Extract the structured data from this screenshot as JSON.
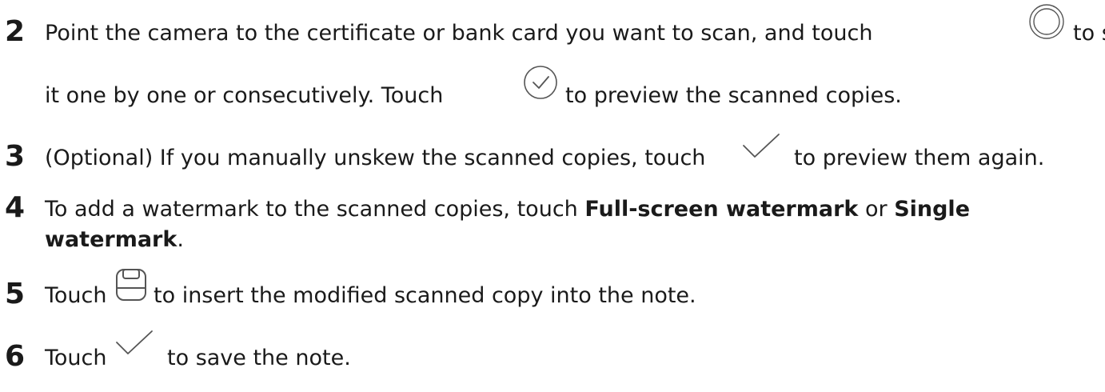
{
  "steps": [
    {
      "number": "2",
      "line1_a": "Point the camera to the certificate or bank card you want to scan, and touch",
      "line1_b": "to scan",
      "line2_a": "it one by one or consecutively. Touch",
      "line2_b": "to preview the scanned copies.",
      "icons": [
        "shutter-circle-icon",
        "check-circle-icon"
      ]
    },
    {
      "number": "3",
      "text_a": "(Optional) If you manually unskew the scanned copies, touch",
      "text_b": "to preview them again.",
      "icons": [
        "checkmark-icon"
      ]
    },
    {
      "number": "4",
      "text_a": "To add a watermark to the scanned copies, touch",
      "bold_a": "Full-screen watermark",
      "text_b": "or",
      "bold_b_line1": "Single",
      "bold_b_line2": "watermark",
      "text_end": "."
    },
    {
      "number": "5",
      "text_a": "Touch",
      "text_b": "to insert the modified scanned copy into the note.",
      "icons": [
        "save-icon"
      ]
    },
    {
      "number": "6",
      "text_a": "Touch",
      "text_b": "to save the note.",
      "icons": [
        "checkmark-icon"
      ]
    }
  ],
  "colors": {
    "text": "#1a1a1a",
    "icon_stroke": "#444444"
  }
}
